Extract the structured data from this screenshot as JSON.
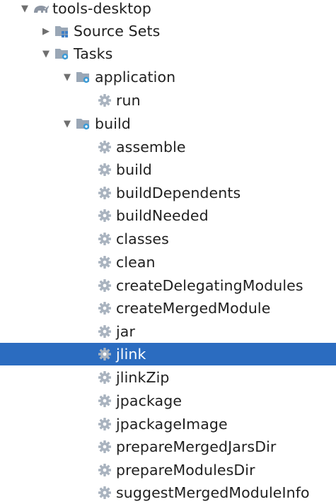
{
  "tree": {
    "root": {
      "label": "tools-desktop",
      "icon": "gradle-elephant-icon",
      "expanded": true
    },
    "source_sets": {
      "label": "Source Sets",
      "icon": "source-sets-folder-icon",
      "expanded": false
    },
    "tasks": {
      "label": "Tasks",
      "icon": "task-folder-icon",
      "expanded": true
    },
    "application": {
      "label": "application",
      "icon": "task-folder-icon",
      "expanded": true
    },
    "application_tasks": [
      {
        "label": "run",
        "icon": "gear-icon"
      }
    ],
    "build": {
      "label": "build",
      "icon": "task-folder-icon",
      "expanded": true
    },
    "build_tasks": [
      {
        "label": "assemble",
        "icon": "gear-icon"
      },
      {
        "label": "build",
        "icon": "gear-icon"
      },
      {
        "label": "buildDependents",
        "icon": "gear-icon"
      },
      {
        "label": "buildNeeded",
        "icon": "gear-icon"
      },
      {
        "label": "classes",
        "icon": "gear-icon"
      },
      {
        "label": "clean",
        "icon": "gear-icon"
      },
      {
        "label": "createDelegatingModules",
        "icon": "gear-icon"
      },
      {
        "label": "createMergedModule",
        "icon": "gear-icon"
      },
      {
        "label": "jar",
        "icon": "gear-icon"
      },
      {
        "label": "jlink",
        "icon": "gear-icon",
        "selected": true
      },
      {
        "label": "jlinkZip",
        "icon": "gear-icon"
      },
      {
        "label": "jpackage",
        "icon": "gear-icon"
      },
      {
        "label": "jpackageImage",
        "icon": "gear-icon"
      },
      {
        "label": "prepareMergedJarsDir",
        "icon": "gear-icon"
      },
      {
        "label": "prepareModulesDir",
        "icon": "gear-icon"
      },
      {
        "label": "suggestMergedModuleInfo",
        "icon": "gear-icon"
      }
    ]
  },
  "colors": {
    "selection": "#2b6cc0",
    "text": "#1f1f1f",
    "selected_text": "#ffffff",
    "gear": "#a9b3bf",
    "folder": "#9aa7b6",
    "gear_badge": "#3c9bd6",
    "grid_badge": "#3d7fc8"
  }
}
